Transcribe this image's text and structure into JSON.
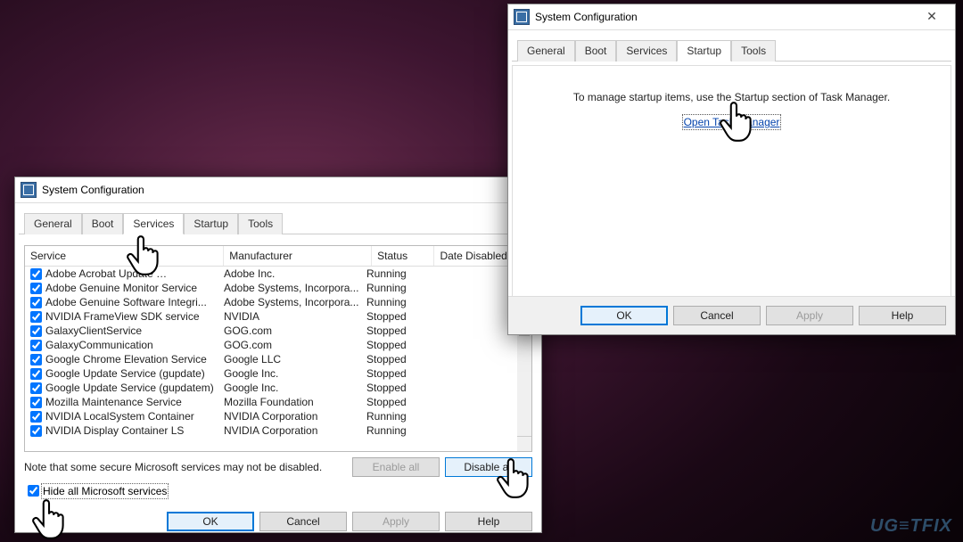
{
  "windows": {
    "servicesWin": {
      "title": "System Configuration",
      "tabs": [
        "General",
        "Boot",
        "Services",
        "Startup",
        "Tools"
      ],
      "activeTab": "Services",
      "columns": {
        "service": "Service",
        "manufacturer": "Manufacturer",
        "status": "Status",
        "dateDisabled": "Date Disabled"
      },
      "rows": [
        {
          "svc": "Adobe Acrobat Update …",
          "mfr": "Adobe Inc.",
          "sta": "Running"
        },
        {
          "svc": "Adobe Genuine Monitor Service",
          "mfr": "Adobe Systems, Incorpora...",
          "sta": "Running"
        },
        {
          "svc": "Adobe Genuine Software Integri...",
          "mfr": "Adobe Systems, Incorpora...",
          "sta": "Running"
        },
        {
          "svc": "NVIDIA FrameView SDK service",
          "mfr": "NVIDIA",
          "sta": "Stopped"
        },
        {
          "svc": "GalaxyClientService",
          "mfr": "GOG.com",
          "sta": "Stopped"
        },
        {
          "svc": "GalaxyCommunication",
          "mfr": "GOG.com",
          "sta": "Stopped"
        },
        {
          "svc": "Google Chrome Elevation Service",
          "mfr": "Google LLC",
          "sta": "Stopped"
        },
        {
          "svc": "Google Update Service (gupdate)",
          "mfr": "Google Inc.",
          "sta": "Stopped"
        },
        {
          "svc": "Google Update Service (gupdatem)",
          "mfr": "Google Inc.",
          "sta": "Stopped"
        },
        {
          "svc": "Mozilla Maintenance Service",
          "mfr": "Mozilla Foundation",
          "sta": "Stopped"
        },
        {
          "svc": "NVIDIA LocalSystem Container",
          "mfr": "NVIDIA Corporation",
          "sta": "Running"
        },
        {
          "svc": "NVIDIA Display Container LS",
          "mfr": "NVIDIA Corporation",
          "sta": "Running"
        }
      ],
      "note": "Note that some secure Microsoft services may not be disabled.",
      "hideLabel": "Hide all Microsoft services",
      "buttons": {
        "enableAll": "Enable all",
        "disableAll": "Disable all",
        "ok": "OK",
        "cancel": "Cancel",
        "apply": "Apply",
        "help": "Help"
      }
    },
    "startupWin": {
      "title": "System Configuration",
      "tabs": [
        "General",
        "Boot",
        "Services",
        "Startup",
        "Tools"
      ],
      "activeTab": "Startup",
      "message": "To manage startup items, use the Startup section of Task Manager.",
      "link": "Open Task Manager",
      "buttons": {
        "ok": "OK",
        "cancel": "Cancel",
        "apply": "Apply",
        "help": "Help"
      }
    }
  },
  "watermark": "UG≡TFIX"
}
